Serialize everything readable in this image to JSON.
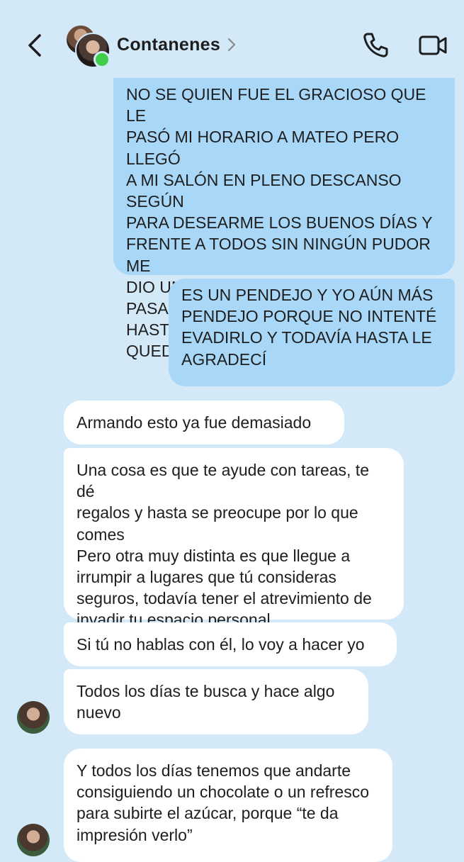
{
  "header": {
    "contact_name": "Contanenes",
    "icons": {
      "back": "chevron-left-icon",
      "details": "chevron-right-icon",
      "call": "phone-icon",
      "video": "video-camera-icon",
      "presence": "online-status-icon"
    },
    "colors": {
      "online": "#3fcd4a"
    }
  },
  "colors": {
    "background": "#d3e9f8",
    "outgoing_bubble": "#a8d7f8",
    "incoming_bubble": "#ffffff",
    "text": "#1e1e1e"
  },
  "messages": [
    {
      "direction": "outgoing",
      "text": "NO SE QUIEN FUE EL GRACIOSO QUE LE\nPASÓ MI HORARIO A MATEO PERO LLEGÓ\nA MI SALÓN EN PLENO DESCANSO SEGÚN\nPARA DESEARME LOS BUENOS DÍAS Y\nFRENTE A TODOS SIN NINGÚN PUDOR ME\nDIO UN BESO UN BESO!!?!!?? QUE LE PASA\nHASTA LA MAESTRA JULIANITA SE ME\nQUEDÓ VIENDO FEO"
    },
    {
      "direction": "outgoing",
      "text": "ES UN PENDEJO Y YO AÚN MÁS\nPENDEJO PORQUE NO INTENTÉ\nEVADIRLO Y TODAVÍA HASTA LE\nAGRADECÍ"
    },
    {
      "direction": "incoming",
      "text": "Armando esto ya fue demasiado"
    },
    {
      "direction": "incoming",
      "text": "Una cosa es que te ayude con tareas, te dé\nregalos y hasta se preocupe por lo que\ncomes\nPero otra muy distinta es que llegue a\nirrumpir a lugares que tú consideras\nseguros, todavía tener el atrevimiento de\ninvadir tu espacio personal"
    },
    {
      "direction": "incoming",
      "text": "Si tú no hablas con él, lo voy a hacer yo"
    },
    {
      "direction": "incoming",
      "text": "Todos los días te busca y hace algo\nnuevo"
    },
    {
      "direction": "incoming",
      "text": "Y todos los días tenemos que andarte\nconsiguiendo un chocolate o un refresco\npara subirte el azúcar, porque “te da\nimpresión verlo”"
    }
  ]
}
